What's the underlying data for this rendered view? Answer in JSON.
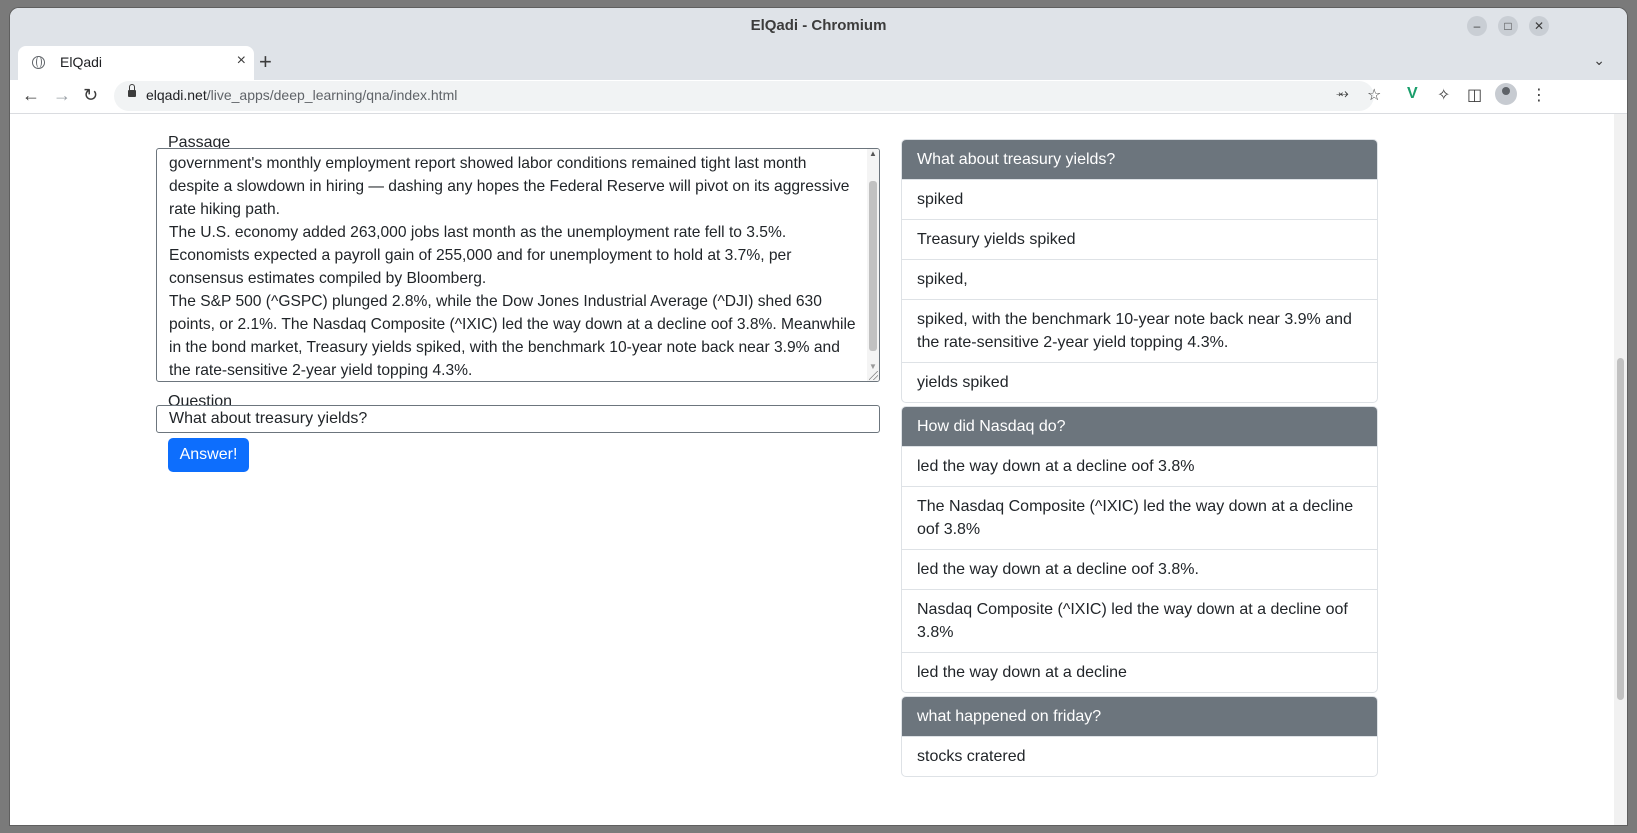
{
  "browser": {
    "window_title": "ElQadi - Chromium",
    "tab_title": "ElQadi",
    "tab_close": "×",
    "new_tab": "+",
    "url_host": "elqadi.net",
    "url_path": "/live_apps/deep_learning/qna/index.html"
  },
  "form": {
    "passage_label": "Passage",
    "passage_text": "government's monthly employment report showed labor conditions remained tight last month despite a slowdown in hiring — dashing any hopes the Federal Reserve will pivot on its aggressive rate hiking path.\nThe U.S. economy added 263,000 jobs last month as the unemployment rate fell to 3.5%. Economists expected a payroll gain of 255,000 and for unemployment to hold at 3.7%, per consensus estimates compiled by Bloomberg.\nThe S&P 500 (^GSPC) plunged 2.8%, while the Dow Jones Industrial Average (^DJI) shed 630 points, or 2.1%. The Nasdaq Composite (^IXIC) led the way down at a decline oof 3.8%. Meanwhile in the bond market, Treasury yields spiked, with the benchmark 10-year note back near 3.9% and the rate-sensitive 2-year yield topping 4.3%.",
    "question_label": "Question",
    "question_value": "What about treasury yields?",
    "answer_button": "Answer!"
  },
  "results": [
    {
      "question": "What about treasury yields?",
      "answers": [
        "spiked",
        "Treasury yields spiked",
        "spiked,",
        "spiked, with the benchmark 10-year note back near 3.9% and the rate-sensitive 2-year yield topping 4.3%.",
        "yields spiked"
      ]
    },
    {
      "question": "How did Nasdaq do?",
      "answers": [
        "led the way down at a decline oof 3.8%",
        "The Nasdaq Composite (^IXIC) led the way down at a decline oof 3.8%",
        "led the way down at a decline oof 3.8%.",
        "Nasdaq Composite (^IXIC) led the way down at a decline oof 3.8%",
        "led the way down at a decline"
      ]
    },
    {
      "question": "what happened on friday?",
      "answers": [
        "stocks cratered"
      ]
    }
  ]
}
